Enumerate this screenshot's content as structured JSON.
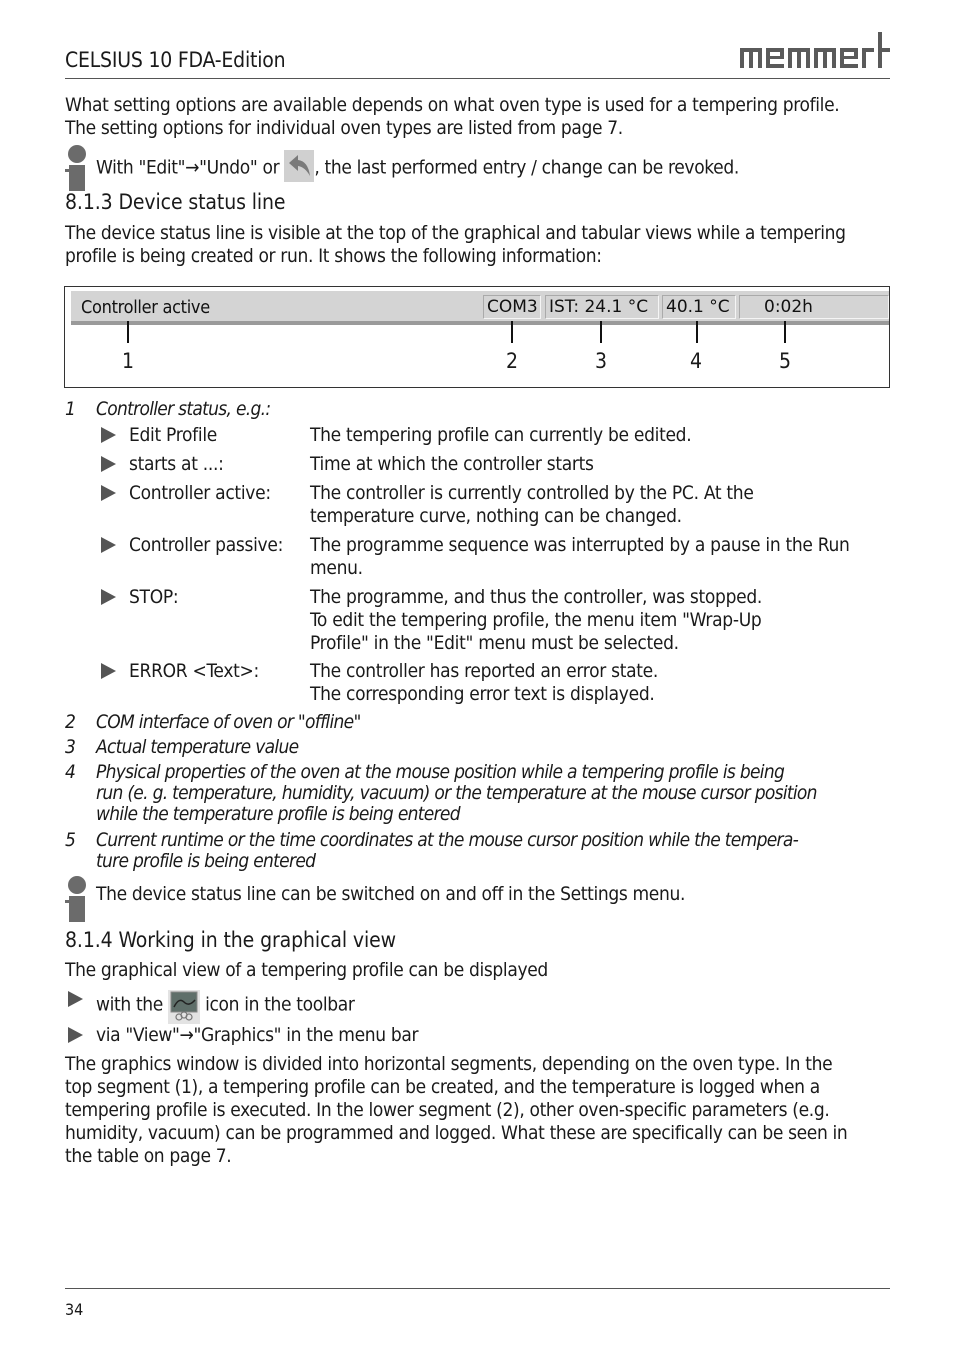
{
  "header": {
    "title": "CELSIUS 10 FDA-Edition",
    "logo_text": "memmert"
  },
  "intro": {
    "line1": "What setting options are available depends on what oven type is used for a tempering profile.",
    "line2": "The setting options for individual oven types are listed from page 7."
  },
  "note_undo": {
    "before": "With \"Edit\"→\"Undo\" or",
    "after": ", the last performed entry / change can be revoked.",
    "icon": "undo-arrow-icon"
  },
  "section_813": {
    "heading": "8.1.3  Device status line",
    "para_line1": "The device status line is visible at the top of the graphical and tabular views while a tempering",
    "para_line2": "profile is being created or run. It shows the following information:"
  },
  "status_bar": {
    "controller_status": "Controller active",
    "com": "COM3",
    "actual_temp": "IST: 24.1 °C",
    "mouse_value": "40.1 °C",
    "runtime": "0:02h",
    "callouts": [
      "1",
      "2",
      "3",
      "4",
      "5"
    ]
  },
  "legend": [
    {
      "num": "1",
      "lines": [
        "Controller status, e.g.:"
      ]
    },
    {
      "num": "2",
      "lines": [
        "COM interface of oven or \"offline\""
      ]
    },
    {
      "num": "3",
      "lines": [
        "Actual temperature value"
      ]
    },
    {
      "num": "4",
      "lines": [
        "Physical properties of the oven at the mouse position while a tempering profile is being",
        "run (e. g. temperature, humidity, vacuum) or the temperature at the mouse cursor position",
        "while the temperature profile is being entered"
      ]
    },
    {
      "num": "5",
      "lines": [
        "Current runtime or the time coordinates at the mouse cursor position while the tempera-",
        "ture profile is being entered"
      ]
    }
  ],
  "controller_states": [
    {
      "term": "Edit Profile",
      "desc": [
        "The tempering profile can currently be edited."
      ]
    },
    {
      "term": "starts at  ...:",
      "desc": [
        "Time at which the controller starts"
      ]
    },
    {
      "term": "Controller active:",
      "desc": [
        "The controller is currently controlled by the PC. At the",
        "temperature curve, nothing can be changed."
      ]
    },
    {
      "term": "Controller passive:",
      "desc": [
        "The programme sequence was interrupted by a pause in the Run",
        "menu."
      ]
    },
    {
      "term": "STOP:",
      "desc": [
        "The programme, and thus the controller, was stopped.",
        "To edit the tempering profile, the menu item \"Wrap-Up",
        "Profile\" in the \"Edit\" menu must be selected."
      ]
    },
    {
      "term": "ERROR <Text>:",
      "desc": [
        "The controller has reported an error state.",
        "The corresponding error text is displayed."
      ]
    }
  ],
  "note_status": {
    "text": "The device status line can be switched on and off in the Settings menu."
  },
  "section_814": {
    "heading": "8.1.4  Working in the graphical view",
    "intro": "The graphical view of a tempering profile can be displayed",
    "bullet1_before": "with the",
    "bullet1_after": "icon in the toolbar",
    "bullet1_icon": "graphics-view-icon",
    "bullet2": "via \"View\"→\"Graphics\" in the menu bar",
    "para": [
      "The graphics window is divided into horizontal segments, depending on the oven type. In the",
      "top segment (1), a tempering profile can be created, and the temperature is logged when a",
      "tempering profile is executed. In the lower segment (2), other oven-specific parameters (e.g.",
      "humidity, vacuum) can be programmed and logged. What these are specifically can be seen in",
      "the table on page 7."
    ]
  },
  "footer": {
    "page_number": "34"
  }
}
